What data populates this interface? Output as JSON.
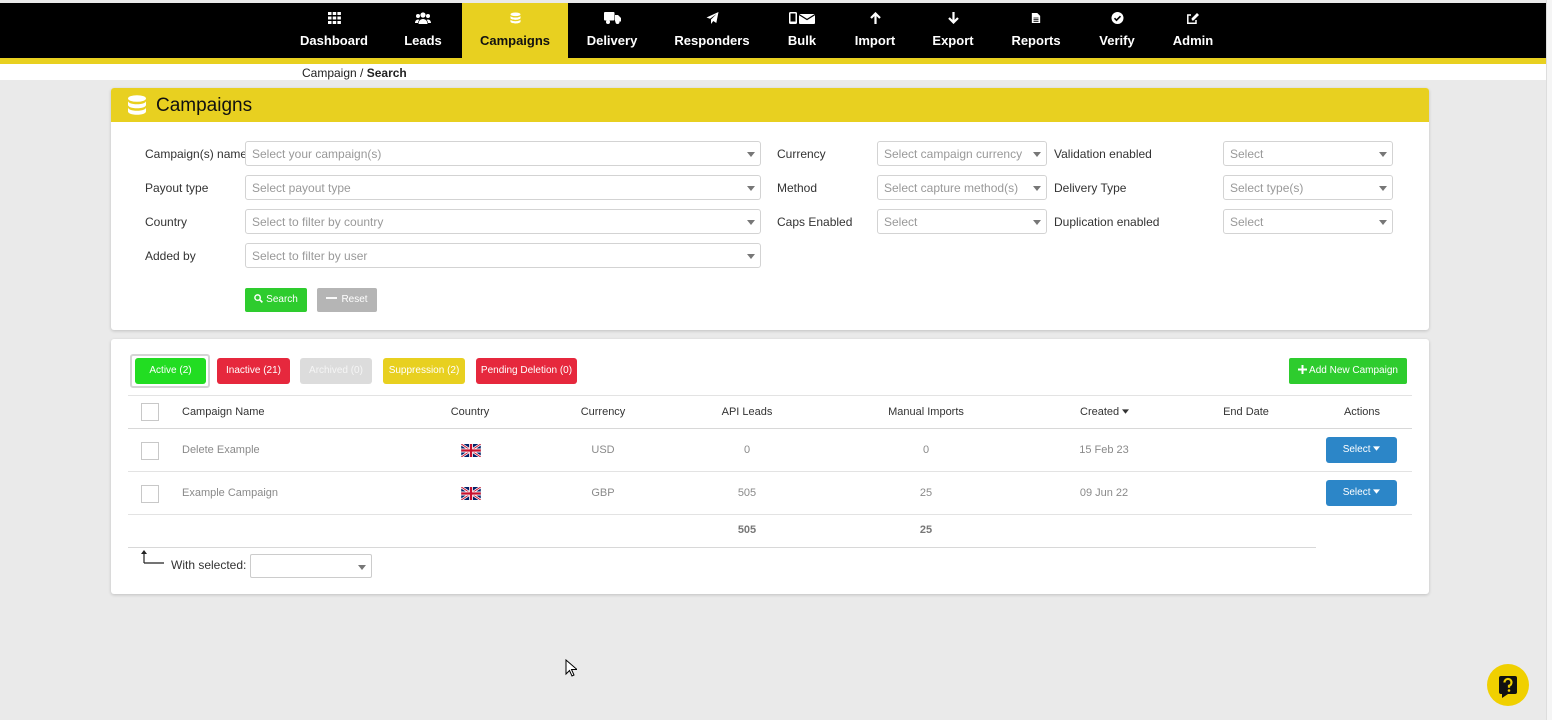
{
  "nav": {
    "items": [
      {
        "label": "Dashboard",
        "icon": "grid-icon"
      },
      {
        "label": "Leads",
        "icon": "users-icon"
      },
      {
        "label": "Campaigns",
        "icon": "database-icon",
        "active": true
      },
      {
        "label": "Delivery",
        "icon": "truck-icon"
      },
      {
        "label": "Responders",
        "icon": "paper-plane-icon"
      },
      {
        "label": "Bulk",
        "icon": "mobile-envelope-icon"
      },
      {
        "label": "Import",
        "icon": "arrow-up-icon"
      },
      {
        "label": "Export",
        "icon": "arrow-down-icon"
      },
      {
        "label": "Reports",
        "icon": "file-icon"
      },
      {
        "label": "Verify",
        "icon": "check-circle-icon"
      },
      {
        "label": "Admin",
        "icon": "edit-icon"
      }
    ]
  },
  "breadcrumb": {
    "parent": "Campaign",
    "separator": " / ",
    "current": "Search"
  },
  "search_panel": {
    "title": "Campaigns",
    "fields": {
      "campaign_name": {
        "label": "Campaign(s) name",
        "placeholder": "Select your campaign(s)"
      },
      "payout_type": {
        "label": "Payout type",
        "placeholder": "Select payout type"
      },
      "country": {
        "label": "Country",
        "placeholder": "Select to filter by country"
      },
      "added_by": {
        "label": "Added by",
        "placeholder": "Select to filter by user"
      },
      "currency": {
        "label": "Currency",
        "placeholder": "Select campaign currency"
      },
      "method": {
        "label": "Method",
        "placeholder": "Select capture method(s)"
      },
      "caps_enabled": {
        "label": "Caps Enabled",
        "placeholder": "Select"
      },
      "validation_enabled": {
        "label": "Validation enabled",
        "placeholder": "Select"
      },
      "delivery_type": {
        "label": "Delivery Type",
        "placeholder": "Select type(s)"
      },
      "duplication_enabled": {
        "label": "Duplication enabled",
        "placeholder": "Select"
      }
    },
    "search_label": "Search",
    "reset_label": "Reset"
  },
  "tabs": {
    "active": "Active (2)",
    "inactive": "Inactive (21)",
    "archived": "Archived (0)",
    "suppression": "Suppression (2)",
    "pending": "Pending Deletion (0)"
  },
  "add_button": "Add New Campaign",
  "table": {
    "headers": {
      "name": "Campaign Name",
      "country": "Country",
      "currency": "Currency",
      "api_leads": "API Leads",
      "manual_imports": "Manual Imports",
      "created": "Created",
      "end_date": "End Date",
      "actions": "Actions"
    },
    "rows": [
      {
        "name": "Delete Example",
        "country": "UK",
        "currency": "USD",
        "api_leads": "0",
        "manual_imports": "0",
        "created": "15 Feb 23",
        "end_date": "",
        "action": "Select"
      },
      {
        "name": "Example Campaign",
        "country": "UK",
        "currency": "GBP",
        "api_leads": "505",
        "manual_imports": "25",
        "created": "09 Jun 22",
        "end_date": "",
        "action": "Select"
      }
    ],
    "totals": {
      "api_leads": "505",
      "manual_imports": "25"
    }
  },
  "with_selected": {
    "label": "With selected:",
    "value": ""
  },
  "colors": {
    "brand_yellow": "#e8d020",
    "success_green": "#2ecc2e",
    "danger_red": "#e6283d",
    "primary_blue": "#2c86c8"
  }
}
